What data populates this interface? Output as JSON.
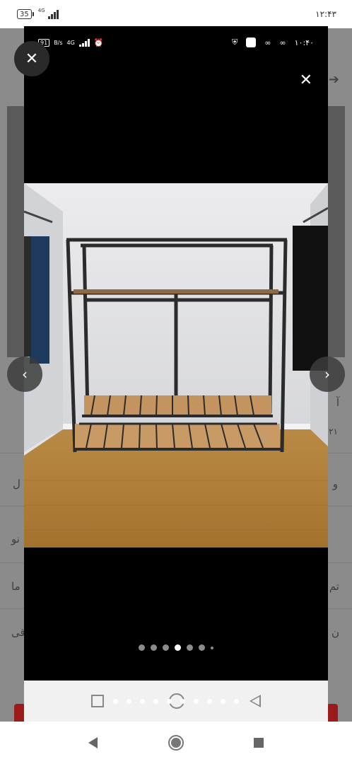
{
  "status_bar": {
    "battery": "35",
    "network": "4G",
    "time": "۱۲:۴۳"
  },
  "inner_status_bar": {
    "battery": "91",
    "speed": "B/s",
    "network": "4G",
    "time": "۱۰:۴۰"
  },
  "background_page": {
    "fragments": [
      "آ",
      "۲۱",
      "ل",
      "و",
      "نو",
      "ما",
      "تم",
      "قی",
      "ن"
    ]
  },
  "gallery": {
    "total_dots": 7,
    "active_index": 3,
    "image_description_icon": "photo"
  },
  "icons": {
    "close": "✕",
    "prev": "‹",
    "next": "›"
  },
  "colors": {
    "viewer_bg": "#000000",
    "dimmed_page": "#8b8b8b",
    "accent_red": "#9b1a1a"
  }
}
